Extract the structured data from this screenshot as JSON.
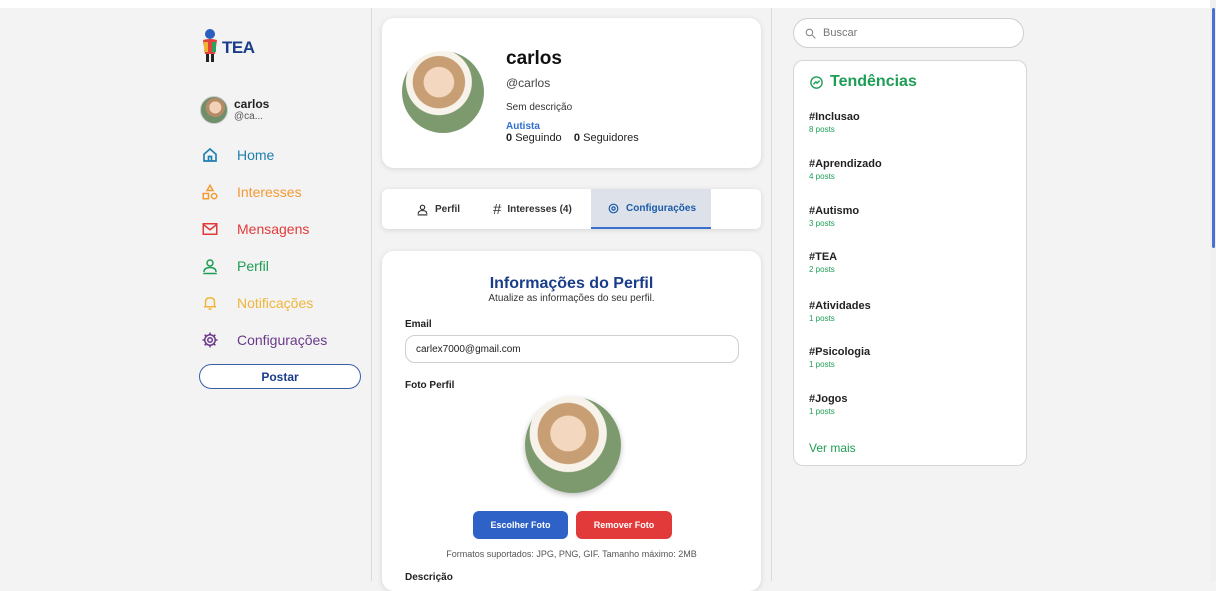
{
  "app": {
    "logo_text": "TEA"
  },
  "user": {
    "name": "carlos",
    "handle": "@ca..."
  },
  "nav": [
    {
      "label": "Home",
      "icon": "home-icon",
      "color": "#1e7fb0"
    },
    {
      "label": "Interesses",
      "icon": "shapes-icon",
      "color": "#f39a35"
    },
    {
      "label": "Mensagens",
      "icon": "mail-icon",
      "color": "#e23a3a"
    },
    {
      "label": "Perfil",
      "icon": "user-icon",
      "color": "#1e9e55"
    },
    {
      "label": "Notificações",
      "icon": "bell-icon",
      "color": "#f0b53a"
    },
    {
      "label": "Configurações",
      "icon": "gear-icon",
      "color": "#6a3a8a"
    }
  ],
  "post_button": "Postar",
  "profile": {
    "name": "carlos",
    "handle": "@carlos",
    "description": "Sem descrição",
    "tag": "Autista",
    "following_count": "0",
    "following_label": "Seguindo",
    "followers_count": "0",
    "followers_label": "Seguidores"
  },
  "tabs": [
    {
      "label": "Perfil",
      "icon": "user-icon",
      "active": false
    },
    {
      "label": "Interesses (4)",
      "icon": "hash-icon",
      "active": false
    },
    {
      "label": "Configurações",
      "icon": "gear-icon",
      "active": true
    }
  ],
  "settings": {
    "title": "Informações do Perfil",
    "subtitle": "Atualize as informações do seu perfil.",
    "email_label": "Email",
    "email_value": "carlex7000@gmail.com",
    "photo_label": "Foto Perfil",
    "choose_button": "Escolher Foto",
    "remove_button": "Remover Foto",
    "formats_note": "Formatos suportados: JPG, PNG, GIF. Tamanho máximo: 2MB",
    "description_label": "Descrição"
  },
  "search": {
    "placeholder": "Buscar"
  },
  "trends": {
    "title": "Tendências",
    "items": [
      {
        "tag": "#Inclusao",
        "count": "8 posts"
      },
      {
        "tag": "#Aprendizado",
        "count": "4 posts"
      },
      {
        "tag": "#Autismo",
        "count": "3 posts"
      },
      {
        "tag": "#TEA",
        "count": "2 posts"
      },
      {
        "tag": "#Atividades",
        "count": "1 posts"
      },
      {
        "tag": "#Psicologia",
        "count": "1 posts"
      },
      {
        "tag": "#Jogos",
        "count": "1 posts"
      }
    ],
    "more": "Ver mais"
  },
  "colors": {
    "accent": "#1a3d8a",
    "green": "#1e9e55",
    "blue_button": "#2f62c7",
    "red_button": "#e23a3a"
  }
}
